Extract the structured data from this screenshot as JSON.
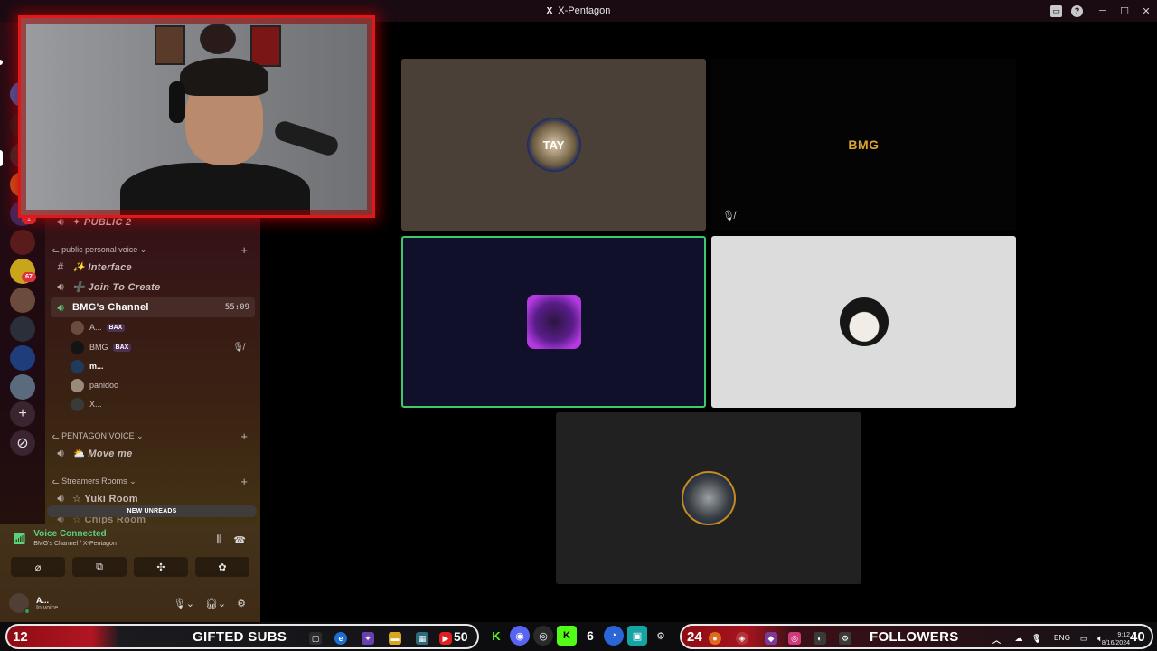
{
  "window": {
    "title": "X-Pentagon",
    "logo_glyph": "X"
  },
  "titlebar_icons": {
    "inbox": "inbox-icon",
    "help": "?"
  },
  "rail": {
    "badges": [
      "1",
      "67"
    ]
  },
  "sidebar": {
    "channels": [
      {
        "name": "✦ PUBLIC 2",
        "type": "voice"
      },
      {
        "name": "✨ Interface",
        "type": "text"
      },
      {
        "name": "➕ Join To Create",
        "type": "voice"
      },
      {
        "name": "BMG's Channel",
        "type": "voice",
        "duration": "55:09"
      },
      {
        "name": "⛅ Move me",
        "type": "voice"
      },
      {
        "name": "☆ Yuki Room",
        "type": "voice"
      },
      {
        "name": "☆ Chips Room",
        "type": "voice"
      }
    ],
    "categories": [
      {
        "name": "ᓚ public personal voice ⌄"
      },
      {
        "name": "ᓚ PENTAGON VOICE ⌄"
      },
      {
        "name": "ᓚ Streamers Rooms ⌄"
      }
    ],
    "voice_users": [
      {
        "name": "A...",
        "tag": "BAX"
      },
      {
        "name": "BMG",
        "tag": "BAX",
        "muted": true
      },
      {
        "name": "m..."
      },
      {
        "name": "panidoo"
      },
      {
        "name": "X..."
      }
    ],
    "new_unreads": "NEW UNREADS"
  },
  "voice_panel": {
    "status": "Voice Connected",
    "channel_path": "BMG's Channel / X-Pentagon",
    "user_name": "A...",
    "user_status": "In voice"
  },
  "stage": {
    "tiles": [
      {
        "label": "tile-1",
        "bg": "#4b4037",
        "pfp_text": "TAY"
      },
      {
        "label": "tile-bmg",
        "bg": "#050404",
        "pfp_text": "BMG",
        "muted": true
      },
      {
        "label": "tile-3",
        "bg": "#10102a",
        "pfp_text": ""
      },
      {
        "label": "tile-4",
        "bg": "#dcdcdc",
        "pfp_text": ""
      },
      {
        "label": "tile-5",
        "bg": "#212121",
        "pfp_text": ""
      }
    ]
  },
  "taskbar": {
    "left_count": "12",
    "left_label": "GIFTED SUBS",
    "yt_count": "50",
    "kick_count": "6",
    "right_count": "24",
    "right_label": "FOLLOWERS",
    "right_end_count": "40",
    "lang": "ENG",
    "time": "9:12",
    "date": "8/16/2024"
  },
  "colors": {
    "accent_red": "#e01818",
    "voice_green": "#5ad17b",
    "speaking_outline": "#3ec96b"
  }
}
